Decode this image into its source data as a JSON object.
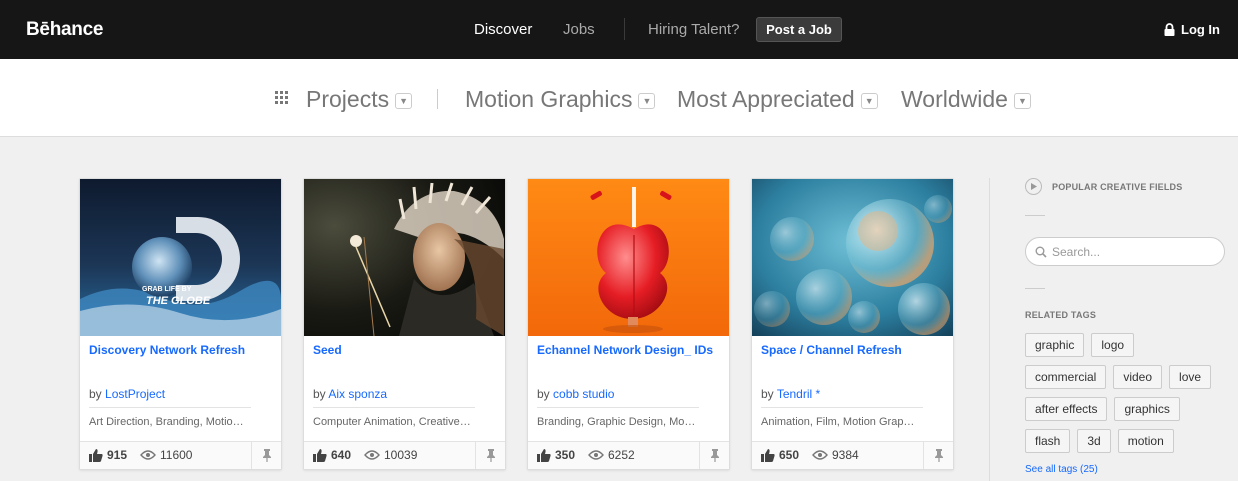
{
  "header": {
    "logo": "Bēhance",
    "nav": {
      "discover": "Discover",
      "jobs": "Jobs",
      "hiring": "Hiring Talent?",
      "post_job": "Post a Job"
    },
    "login": "Log In"
  },
  "filters": {
    "projects": "Projects",
    "field": "Motion Graphics",
    "sort": "Most Appreciated",
    "location": "Worldwide"
  },
  "cards": [
    {
      "title": "Discovery Network Refresh",
      "by": "by",
      "author": "LostProject",
      "fields": "Art Direction, Branding, Motio…",
      "appreciations": "915",
      "views": "11600",
      "thumb_text_1": "GRAB LIFE BY",
      "thumb_text_2": "THE GLOBE"
    },
    {
      "title": "Seed",
      "by": "by",
      "author": "Aix sponza",
      "fields": "Computer Animation, Creative…",
      "appreciations": "640",
      "views": "10039"
    },
    {
      "title": "Echannel Network Design_ IDs",
      "by": "by",
      "author": "cobb studio",
      "fields": "Branding, Graphic Design, Mo…",
      "appreciations": "350",
      "views": "6252"
    },
    {
      "title": "Space / Channel Refresh",
      "by": "by",
      "author": "Tendril *",
      "fields": "Animation, Film, Motion Grap…",
      "appreciations": "650",
      "views": "9384"
    }
  ],
  "sidebar": {
    "popular_label": "POPULAR CREATIVE FIELDS",
    "search_placeholder": "Search...",
    "related_label": "RELATED TAGS",
    "tags": [
      [
        "graphic",
        "logo"
      ],
      [
        "commercial",
        "video",
        "love"
      ],
      [
        "after effects",
        "graphics"
      ],
      [
        "flash",
        "3d",
        "motion"
      ]
    ],
    "see_all": "See all tags (25)"
  }
}
